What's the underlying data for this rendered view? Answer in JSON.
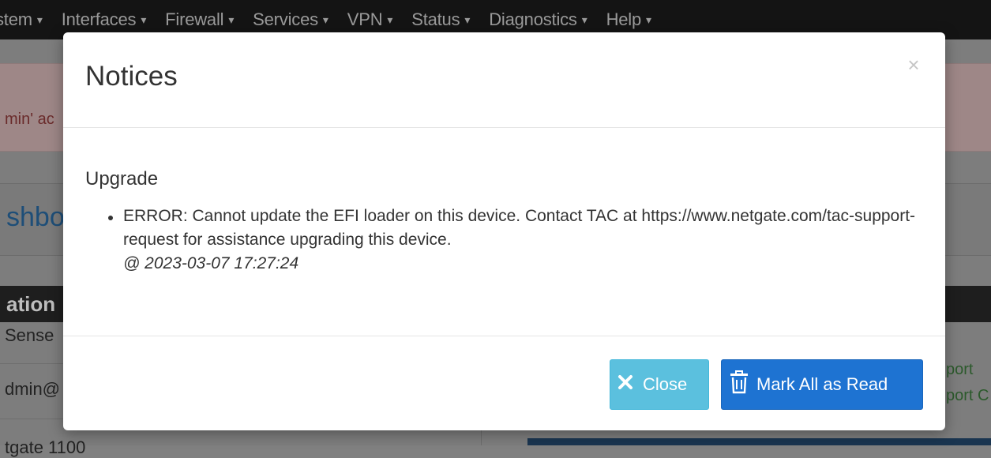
{
  "background": {
    "navbar": {
      "items": [
        {
          "label": "stem"
        },
        {
          "label": "Interfaces"
        },
        {
          "label": "Firewall"
        },
        {
          "label": "Services"
        },
        {
          "label": "VPN"
        },
        {
          "label": "Status"
        },
        {
          "label": "Diagnostics"
        },
        {
          "label": "Help"
        }
      ],
      "caret": "▾"
    },
    "alert_text": "min' ac",
    "crumb_text": "shbo",
    "panel_header": "ation",
    "panel_rows": [
      "Sense",
      "dmin@",
      "tgate 1100"
    ],
    "right_links": [
      "port",
      "port C"
    ]
  },
  "modal": {
    "title": "Notices",
    "close_symbol": "×",
    "section_title": "Upgrade",
    "notices": [
      {
        "text": "ERROR: Cannot update the EFI loader on this device. Contact TAC at https://www.netgate.com/tac-support-request for assistance upgrading this device.",
        "timestamp": "@ 2023-03-07 17:27:24"
      }
    ],
    "buttons": {
      "close_label": "Close",
      "mark_read_label": "Mark All as Read"
    }
  },
  "colors": {
    "close_button": "#5bc0de",
    "mark_read_button": "#1e73d2",
    "navbar": "#141414"
  },
  "icons": {
    "close_button_icon": "x-icon",
    "mark_read_icon": "trash-icon",
    "modal_close": "close-icon"
  }
}
